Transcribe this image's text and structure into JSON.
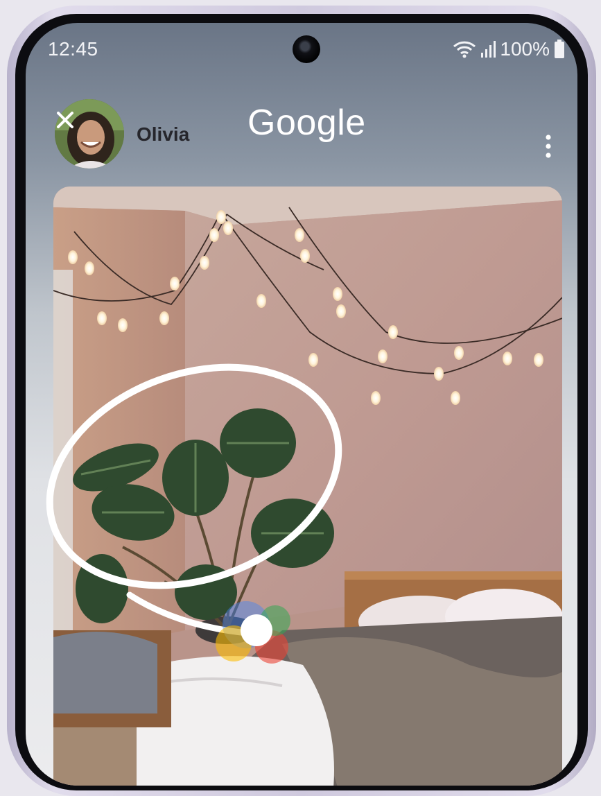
{
  "status_bar": {
    "time": "12:45",
    "battery": "100%",
    "icons": [
      "wifi-icon",
      "signal-icon",
      "battery-icon"
    ]
  },
  "header": {
    "close_icon": "close-icon",
    "user_name": "Olivia",
    "title": "Google",
    "menu_icon": "more-vert-icon"
  },
  "colors": {
    "frame": "#d9d4e6",
    "accent_blue": "#4285F4",
    "accent_red": "#EA4335",
    "accent_yellow": "#FBBC05",
    "accent_green": "#34A853"
  }
}
